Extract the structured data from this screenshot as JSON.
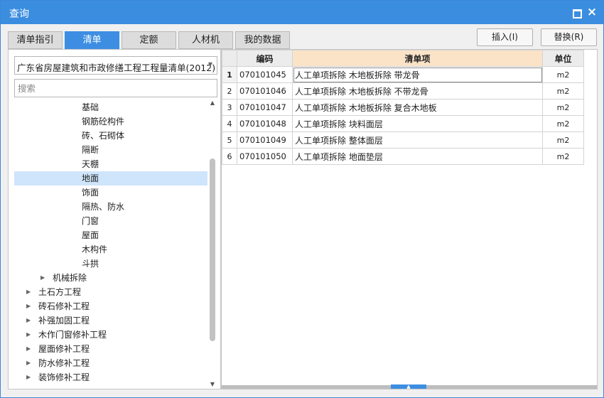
{
  "window": {
    "title": "查询"
  },
  "tabs": [
    {
      "label": "清单指引",
      "active": false
    },
    {
      "label": "清单",
      "active": true
    },
    {
      "label": "定额",
      "active": false
    },
    {
      "label": "人材机",
      "active": false
    },
    {
      "label": "我的数据",
      "active": false
    }
  ],
  "buttons": {
    "insert": "插入(I)",
    "replace": "替换(R)"
  },
  "library_select": {
    "value": "广东省房屋建筑和市政修缮工程工程量清单(2012)"
  },
  "search": {
    "placeholder": "搜索",
    "value": ""
  },
  "tree": [
    {
      "label": "基础",
      "level": 3,
      "expander": false,
      "selected": false
    },
    {
      "label": "钢筋砼构件",
      "level": 3,
      "expander": false,
      "selected": false
    },
    {
      "label": "砖、石砌体",
      "level": 3,
      "expander": false,
      "selected": false
    },
    {
      "label": "隔断",
      "level": 3,
      "expander": false,
      "selected": false
    },
    {
      "label": "天棚",
      "level": 3,
      "expander": false,
      "selected": false
    },
    {
      "label": "地面",
      "level": 3,
      "expander": false,
      "selected": true
    },
    {
      "label": "饰面",
      "level": 3,
      "expander": false,
      "selected": false
    },
    {
      "label": "隔热、防水",
      "level": 3,
      "expander": false,
      "selected": false
    },
    {
      "label": "门窗",
      "level": 3,
      "expander": false,
      "selected": false
    },
    {
      "label": "屋面",
      "level": 3,
      "expander": false,
      "selected": false
    },
    {
      "label": "木构件",
      "level": 3,
      "expander": false,
      "selected": false
    },
    {
      "label": "斗拱",
      "level": 3,
      "expander": false,
      "selected": false
    },
    {
      "label": "机械拆除",
      "level": 2,
      "expander": true,
      "selected": false
    },
    {
      "label": "土石方工程",
      "level": 1,
      "expander": true,
      "selected": false
    },
    {
      "label": "砖石修补工程",
      "level": 1,
      "expander": true,
      "selected": false
    },
    {
      "label": "补强加固工程",
      "level": 1,
      "expander": true,
      "selected": false
    },
    {
      "label": "木作门窗修补工程",
      "level": 1,
      "expander": true,
      "selected": false
    },
    {
      "label": "屋面修补工程",
      "level": 1,
      "expander": true,
      "selected": false
    },
    {
      "label": "防水修补工程",
      "level": 1,
      "expander": true,
      "selected": false
    },
    {
      "label": "装饰修补工程",
      "level": 1,
      "expander": true,
      "selected": false
    }
  ],
  "table": {
    "columns": [
      "编码",
      "清单项",
      "单位"
    ],
    "rows": [
      {
        "no": "1",
        "code": "070101045",
        "name": "人工单项拆除 木地板拆除 带龙骨",
        "unit": "m2"
      },
      {
        "no": "2",
        "code": "070101046",
        "name": "人工单项拆除 木地板拆除 不带龙骨",
        "unit": "m2"
      },
      {
        "no": "3",
        "code": "070101047",
        "name": "人工单项拆除 木地板拆除 复合木地板",
        "unit": "m2"
      },
      {
        "no": "4",
        "code": "070101048",
        "name": "人工单项拆除 块料面层",
        "unit": "m2"
      },
      {
        "no": "5",
        "code": "070101049",
        "name": "人工单项拆除 整体面层",
        "unit": "m2"
      },
      {
        "no": "6",
        "code": "070101050",
        "name": "人工单项拆除 地面垫层",
        "unit": "m2"
      }
    ]
  },
  "icons": {
    "maximize": "maximize-icon",
    "close": "close-icon",
    "dropdown": "chevron-down-icon",
    "expander": "triangle-right-icon"
  },
  "colors": {
    "accent": "#3b8de0",
    "selected_row": "#cfe5fb",
    "header_highlight": "#fbe3c8"
  }
}
